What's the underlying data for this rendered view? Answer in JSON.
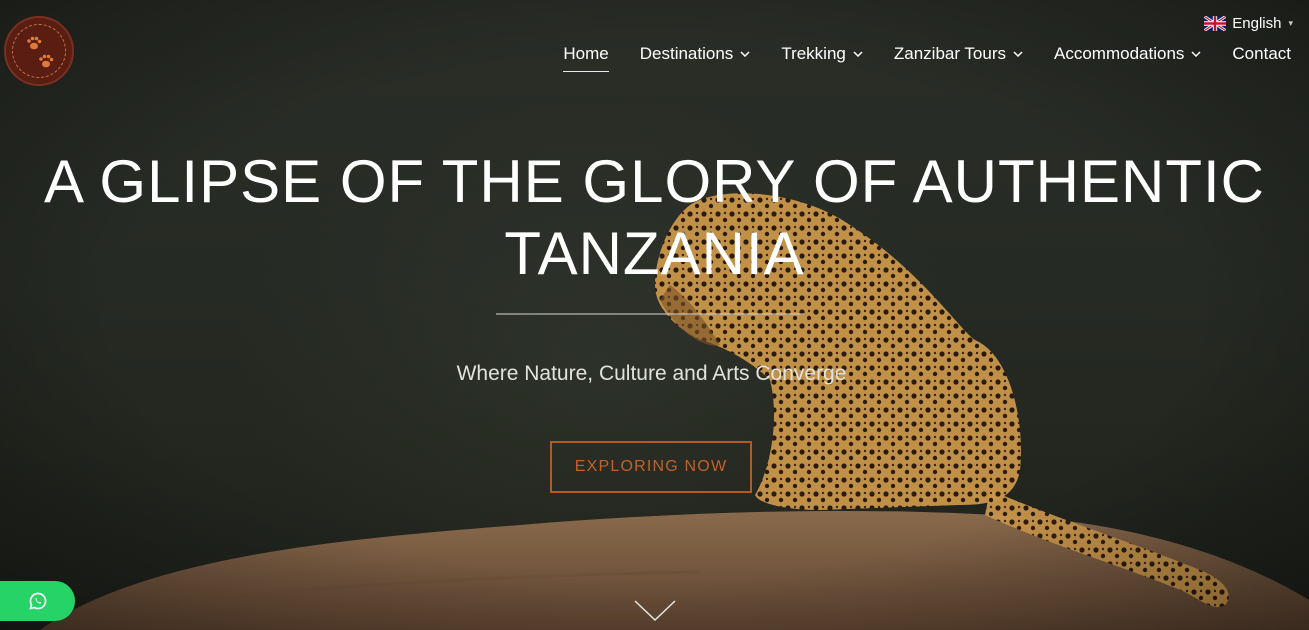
{
  "header": {
    "language": {
      "label": "English",
      "flag_icon": "uk-flag-icon"
    },
    "nav": [
      {
        "label": "Home",
        "active": true,
        "has_dropdown": false
      },
      {
        "label": "Destinations",
        "active": false,
        "has_dropdown": true
      },
      {
        "label": "Trekking",
        "active": false,
        "has_dropdown": true
      },
      {
        "label": "Zanzibar Tours",
        "active": false,
        "has_dropdown": true
      },
      {
        "label": "Accommodations",
        "active": false,
        "has_dropdown": true
      },
      {
        "label": "Contact",
        "active": false,
        "has_dropdown": false
      }
    ]
  },
  "hero": {
    "headline_line1": "A GLIPSE OF THE GLORY OF AUTHENTIC",
    "headline_line2": "TANZANIA",
    "tagline": "Where Nature, Culture and Arts Converge",
    "cta_label": "EXPLORING NOW",
    "scroll_icon": "chevron-down-icon"
  },
  "floating": {
    "whatsapp_icon": "whatsapp-icon"
  },
  "colors": {
    "cta_accent": "#b65a1e",
    "whatsapp_green": "#25d366",
    "logo_bg": "#5a1d12"
  }
}
